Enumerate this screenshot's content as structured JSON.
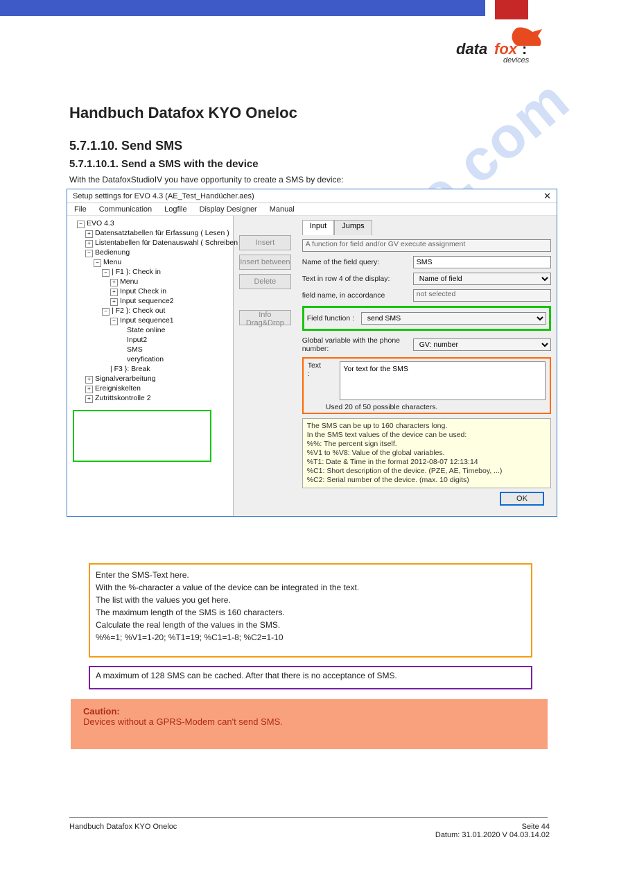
{
  "brand": {
    "name": "datafox:",
    "sub": "devices",
    "colors": {
      "blue": "#3d5ac6",
      "red": "#c62828",
      "accent": "#e84a1f"
    }
  },
  "page": {
    "title": "Handbuch Datafox KYO Oneloc",
    "heading1": "5.7.1.10. Send SMS",
    "heading2": "5.7.1.10.1. Send a SMS with the device",
    "intro": "With the DatafoxStudioIV you have opportunity to create a SMS by device:",
    "orange_box": [
      "Enter the SMS-Text here.",
      "With the %-character a value of the device can be integrated in the text.",
      "The list with the values you get here.",
      "The maximum length of the SMS is 160 characters.",
      "Calculate the real length of the values in the SMS.",
      "%%=1; %V1=1-20; %T1=19; %C1=1-8; %C2=1-10"
    ],
    "purple_box": "A maximum of 128 SMS can be cached. After that there is no acceptance of SMS.",
    "salmon_box": [
      "Caution:",
      "Devices without a GPRS-Modem can't send SMS."
    ],
    "footer_left": "Handbuch Datafox KYO Oneloc",
    "footer_right": "Seite 44\nDatum: 31.01.2020 V 04.03.14.02"
  },
  "window": {
    "title": "Setup settings for EVO 4.3    (AE_Test_Handücher.aes)",
    "close": "✕",
    "menu": [
      "File",
      "Communication",
      "Logfile",
      "Display Designer",
      "Manual"
    ],
    "tree": {
      "root": "EVO 4.3",
      "items": [
        "Datensatztabellen für Erfassung ( Lesen )",
        "Listentabellen für Datenauswahl ( Schreiben )",
        "Bedienung",
        "Menu",
        "| F1 }: Check in",
        "Menu",
        "Input Check in",
        "Input sequence2",
        "| F2 }: Check out",
        "Input sequence1",
        "State online",
        "Input2",
        "SMS",
        "veryfication",
        "| F3 }: Break",
        "Signalverarbeitung",
        "Ereigniskelten",
        "Zutrittskontrolle 2"
      ]
    },
    "buttons": {
      "insert": "Insert",
      "insert_between": "Insert between",
      "delete": "Delete",
      "info": "Info Drag&Drop"
    },
    "tabs": {
      "input": "Input",
      "jumps": "Jumps"
    },
    "form": {
      "func_desc": "A function for field and/or GV execute assignment",
      "name_label": "Name of the field query:",
      "name_value": "SMS",
      "row4_label": "Text in row 4 of the display:",
      "row4_value": "Name of field",
      "fieldname_label": "field name, in accordance",
      "fieldname_value": "not selected",
      "fieldfunc_label": "Field function :",
      "fieldfunc_value": "send SMS",
      "gv_label": "Global variable with the phone number:",
      "gv_value": "GV: number",
      "text_label": "Text :",
      "text_value": "Yor text for the SMS",
      "used": "Used 20 of 50 possible characters.",
      "info": "The SMS can be up to 160 characters long.\nIn the SMS text values of the device can be used:\n%%: The percent sign itself.\n%V1 to %V8: Value of the global variables.\n%T1: Date & Time in the format 2012-08-07 12:13:14\n%C1: Short description of the device. (PZE, AE, Timeboy, ...)\n%C2: Serial number of the device. (max. 10 digits)"
    },
    "ok": "OK"
  },
  "watermark": "manualshive.com"
}
